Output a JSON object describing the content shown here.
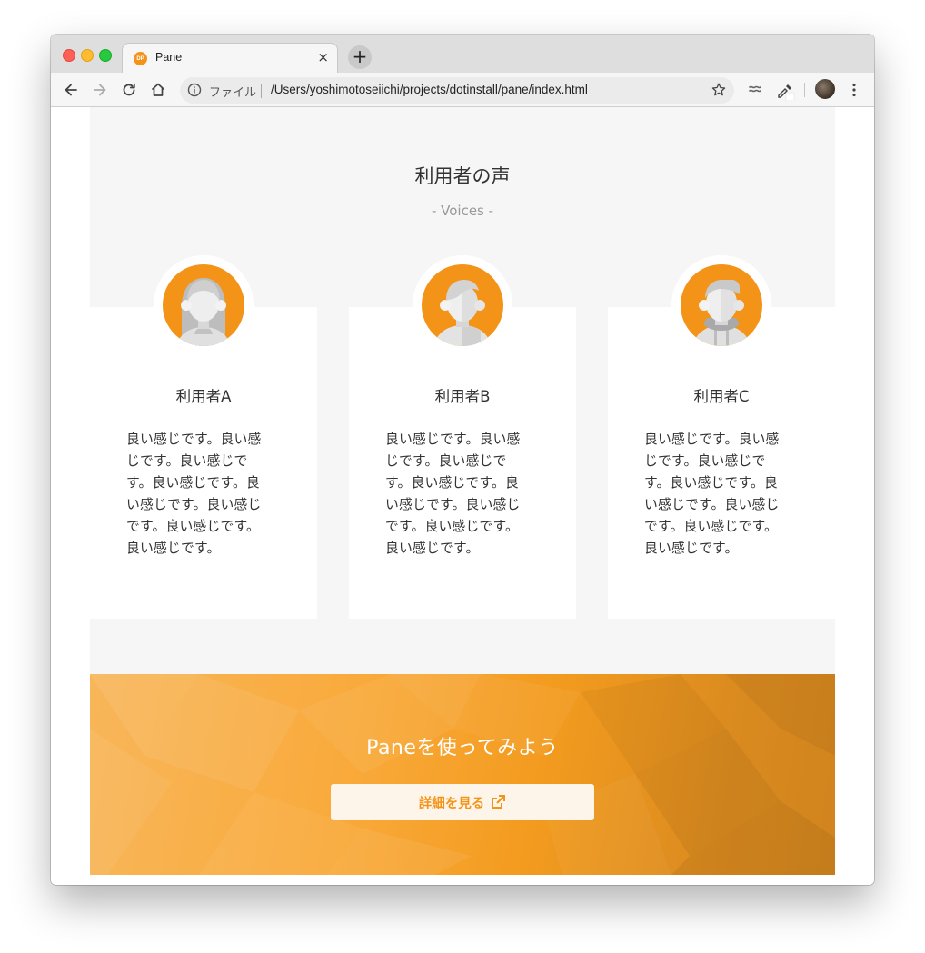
{
  "browser": {
    "tab_title": "Pane",
    "favicon_text": "DP",
    "tab_close": "×",
    "new_tab": "+",
    "address_scheme_label": "ファイル",
    "url": "/Users/yoshimotoseiichi/projects/dotinstall/pane/index.html"
  },
  "voices": {
    "title": "利用者の声",
    "subtitle": "- Voices -",
    "cards": [
      {
        "name": "利用者A",
        "text": "良い感じです。良い感じです。良い感じです。良い感じです。良い感じです。良い感じです。良い感じです。良い感じです。",
        "avatar": "woman-avatar-icon"
      },
      {
        "name": "利用者B",
        "text": "良い感じです。良い感じです。良い感じです。良い感じです。良い感じです。良い感じです。良い感じです。良い感じです。",
        "avatar": "man-avatar-icon"
      },
      {
        "name": "利用者C",
        "text": "良い感じです。良い感じです。良い感じです。良い感じです。良い感じです。良い感じです。良い感じです。良い感じです。",
        "avatar": "man-headphones-avatar-icon"
      }
    ]
  },
  "cta": {
    "title": "Paneを使ってみよう",
    "button_label": "詳細を見る",
    "button_icon": "external-link-icon"
  },
  "colors": {
    "accent": "#f39419",
    "section_bg": "#f6f6f6",
    "button_bg": "#fef5ea"
  }
}
